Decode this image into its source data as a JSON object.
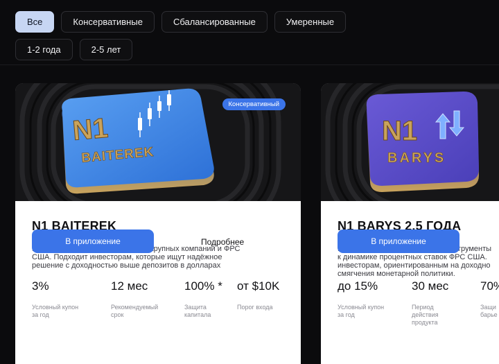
{
  "filters": {
    "row1": [
      "Все",
      "Консервативные",
      "Сбалансированные",
      "Умеренные"
    ],
    "row2": [
      "1-2 года",
      "2-5 лет"
    ],
    "active": "Все"
  },
  "cards": [
    {
      "logo_top": "N1",
      "logo_bottom": "BAITEREK",
      "badge": "Консервативный",
      "title": "N1 BAITEREK",
      "description": "Инвестиции в акции и облигации крупных компаний и ФРС\nСША. Подходит инвесторам, которые ищут надёжное\nрешение с доходностью выше депозитов в долларах",
      "stats": [
        {
          "value": "3%",
          "label": "Условный купон\nза год"
        },
        {
          "value": "12 мес",
          "label": "Рекомендуемый\nсрок"
        },
        {
          "value": "100% *",
          "label": "Защита\nкапитала"
        },
        {
          "value": "от $10K",
          "label": "Порог входа"
        }
      ],
      "button": "В приложение",
      "link": "Подробнее"
    },
    {
      "logo_top": "N1",
      "logo_bottom": "BARYS",
      "title": "N1 BARYS 2,5 ГОДА",
      "description": "Инвестиции в облигационные инструменты\nк динамике процентных ставок ФРС США.\nинвесторам, ориентированным на доходно\nсмягчения монетарной политики.",
      "stats": [
        {
          "value": "до 15%",
          "label": "Условный купон\nза год"
        },
        {
          "value": "30 мес",
          "label": "Период\nдействия\nпродукта"
        },
        {
          "value": "70%",
          "label": "Защи\nбарье"
        }
      ],
      "button": "В приложение"
    }
  ],
  "colors": {
    "background": "#0b0b0d",
    "accent": "#3b74e8",
    "chip_active": "#c7d6f3",
    "baiterek_tile": "#3f86e6",
    "barys_tile": "#5b4fc8",
    "logo_gold": "#c9a35c"
  }
}
